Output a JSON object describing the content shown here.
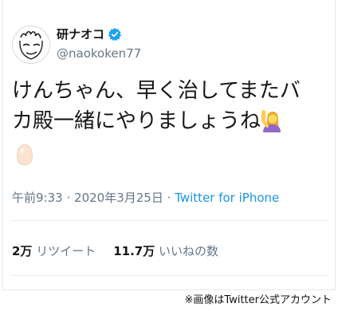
{
  "tweet": {
    "display_name": "研ナオコ",
    "handle": "@naokoken77",
    "text_line1": "けんちゃん、早く治してまたバ",
    "text_line2": "カ殿一緒にやりましょうね",
    "time": "午前9:33",
    "separator": "·",
    "date": "2020年3月25日",
    "source": "Twitter for iPhone",
    "retweet_count": "2万",
    "retweet_label": "リツイート",
    "like_count": "11.7万",
    "like_label": "いいねの数"
  },
  "icons": {
    "verified": "verified-badge-icon",
    "emoji_1": "woman-raising-hand-icon",
    "emoji_2": "egg-icon"
  },
  "colors": {
    "verified": "#1da1f2",
    "link": "#1b95e0",
    "muted": "#657786",
    "text": "#14171a"
  },
  "caption": "※画像はTwitter公式アカウント"
}
